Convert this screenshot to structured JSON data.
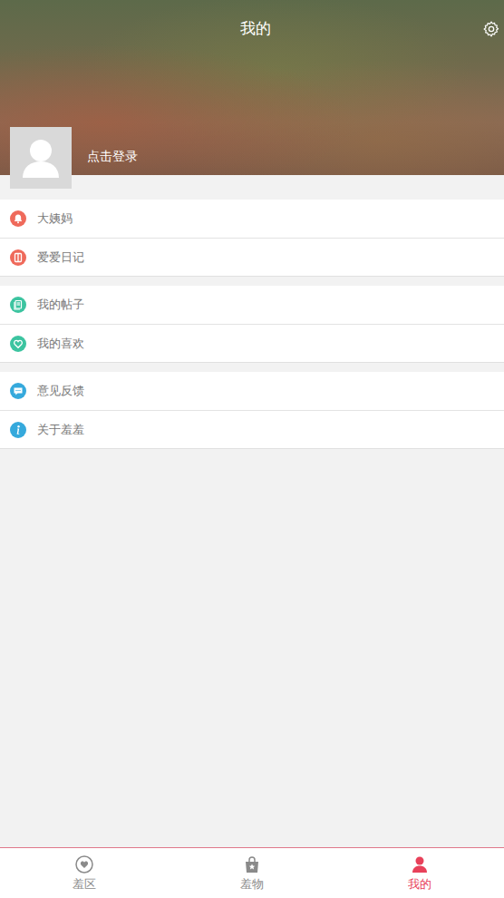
{
  "header": {
    "title": "我的",
    "login": "点击登录"
  },
  "groups": [
    {
      "items": [
        {
          "label": "大姨妈",
          "color": "#ef6a5b",
          "icon": "bell"
        },
        {
          "label": "爱爱日记",
          "color": "#ef6a5b",
          "icon": "book"
        }
      ]
    },
    {
      "items": [
        {
          "label": "我的帖子",
          "color": "#3cc4a0",
          "icon": "doc"
        },
        {
          "label": "我的喜欢",
          "color": "#3cc4a0",
          "icon": "heart"
        }
      ]
    },
    {
      "items": [
        {
          "label": "意见反馈",
          "color": "#35a9dc",
          "icon": "chat"
        },
        {
          "label": "关于羞羞",
          "color": "#35a9dc",
          "icon": "info"
        }
      ]
    }
  ],
  "tabs": [
    {
      "label": "羞区",
      "selected": false,
      "icon": "zone"
    },
    {
      "label": "羞物",
      "selected": false,
      "icon": "bag"
    },
    {
      "label": "我的",
      "selected": true,
      "icon": "person"
    }
  ]
}
